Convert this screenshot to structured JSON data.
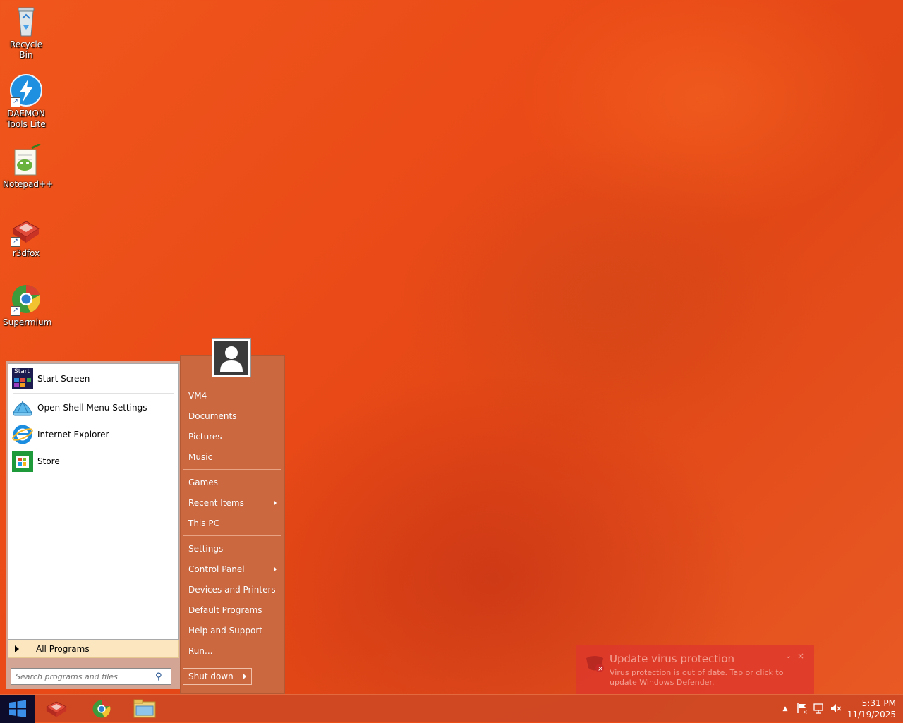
{
  "desktop": {
    "icons": [
      {
        "label": "Recycle Bin",
        "icon": "recycle-bin-icon"
      },
      {
        "label1": "DAEMON",
        "label2": "Tools Lite",
        "icon": "daemon-tools-icon"
      },
      {
        "label": "Notepad++",
        "icon": "notepad-plus-plus-icon"
      },
      {
        "label": "r3dfox",
        "icon": "r3dfox-icon"
      },
      {
        "label": "Supermium",
        "icon": "supermium-icon"
      }
    ]
  },
  "start_menu": {
    "programs": [
      {
        "label": "Start Screen",
        "icon": "start-screen-icon"
      },
      {
        "label": "Open-Shell Menu Settings",
        "icon": "open-shell-icon"
      },
      {
        "label": "Internet Explorer",
        "icon": "internet-explorer-icon"
      },
      {
        "label": "Store",
        "icon": "store-icon"
      }
    ],
    "start_screen_badge": "Start",
    "all_programs": "All Programs",
    "search_placeholder": "Search programs and files",
    "right": {
      "user": "VM4",
      "documents": "Documents",
      "pictures": "Pictures",
      "music": "Music",
      "games": "Games",
      "recent_items": "Recent Items",
      "this_pc": "This PC",
      "settings": "Settings",
      "control_panel": "Control Panel",
      "devices_printers": "Devices and Printers",
      "default_programs": "Default Programs",
      "help_support": "Help and Support",
      "run": "Run..."
    },
    "shutdown": "Shut down"
  },
  "notification": {
    "title": "Update virus protection",
    "body": "Virus protection is out of date. Tap or click to update Windows Defender.",
    "close": "×",
    "minimize": "⌄"
  },
  "taskbar": {
    "pinned": [
      "r3dfox-icon",
      "supermium-icon",
      "file-explorer-icon"
    ],
    "tray": [
      "show-hidden-icons-icon",
      "action-center-flag-icon",
      "network-icon",
      "volume-muted-icon"
    ],
    "time": "5:31 PM",
    "date": "11/19/2025"
  },
  "colors": {
    "start_right_pane": "#cc6840",
    "taskbar": "#cd4823",
    "toast": "#de372d"
  }
}
